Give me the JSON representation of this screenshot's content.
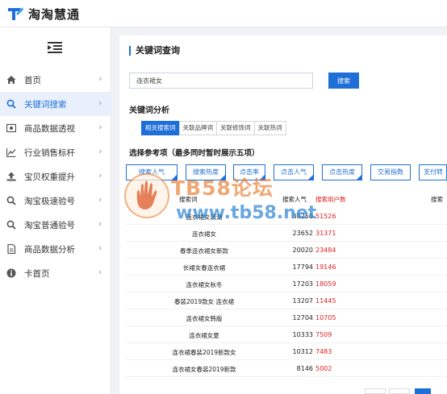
{
  "app": {
    "logo_text": "淘淘慧通"
  },
  "sidebar": {
    "items": [
      {
        "label": "首页",
        "icon": "home-icon"
      },
      {
        "label": "关键词搜索",
        "icon": "search-icon",
        "active": true
      },
      {
        "label": "商品数据透视",
        "icon": "image-icon"
      },
      {
        "label": "行业销售标杆",
        "icon": "line-chart-icon"
      },
      {
        "label": "宝贝权重提升",
        "icon": "upload-icon"
      },
      {
        "label": "淘宝极速验号",
        "icon": "search-icon"
      },
      {
        "label": "淘宝普通验号",
        "icon": "search-icon"
      },
      {
        "label": "商品数据分析",
        "icon": "document-icon"
      },
      {
        "label": "卡首页",
        "icon": "info-icon"
      }
    ]
  },
  "main": {
    "section_title": "关键词查询",
    "search": {
      "value": "连衣裙女",
      "button_label": "搜索"
    },
    "analysis_title": "关键词分析",
    "tabs": [
      "相关搜索词",
      "关联品牌词",
      "关联修饰词",
      "关联热词"
    ],
    "ref_title": "选择参考项（最多同时暂时展示五项）",
    "options": [
      "搜索人气",
      "搜索热度",
      "点击率",
      "点击人气",
      "点击热度",
      "交易指数",
      "支付转"
    ],
    "table": {
      "headers": [
        "搜索词",
        "搜索人气",
        "搜索用户数",
        "搜索"
      ],
      "rows": [
        {
          "keyword": "连衣裙女装潮",
          "popularity": "30250",
          "users": "51526"
        },
        {
          "keyword": "连衣裙女",
          "popularity": "23652",
          "users": "31371"
        },
        {
          "keyword": "春季连衣裙女新款",
          "popularity": "20020",
          "users": "23484"
        },
        {
          "keyword": "长裙女春连衣裙",
          "popularity": "17794",
          "users": "19146"
        },
        {
          "keyword": "连衣裙女秋冬",
          "popularity": "17203",
          "users": "18059"
        },
        {
          "keyword": "春装2019款女 连衣裙",
          "popularity": "13207",
          "users": "11445"
        },
        {
          "keyword": "连衣裙女韩版",
          "popularity": "12704",
          "users": "10705"
        },
        {
          "keyword": "连衣裙女夏",
          "popularity": "10333",
          "users": "7509"
        },
        {
          "keyword": "连衣裙春装2019新款女",
          "popularity": "10312",
          "users": "7483"
        },
        {
          "keyword": "连衣裙女春装2019新款",
          "popularity": "8146",
          "users": "5002"
        }
      ]
    }
  },
  "watermark": {
    "line1": "TB58论坛",
    "line2": "www.tb58.net"
  },
  "colors": {
    "accent": "#1f6fd8",
    "danger": "#e02020"
  }
}
